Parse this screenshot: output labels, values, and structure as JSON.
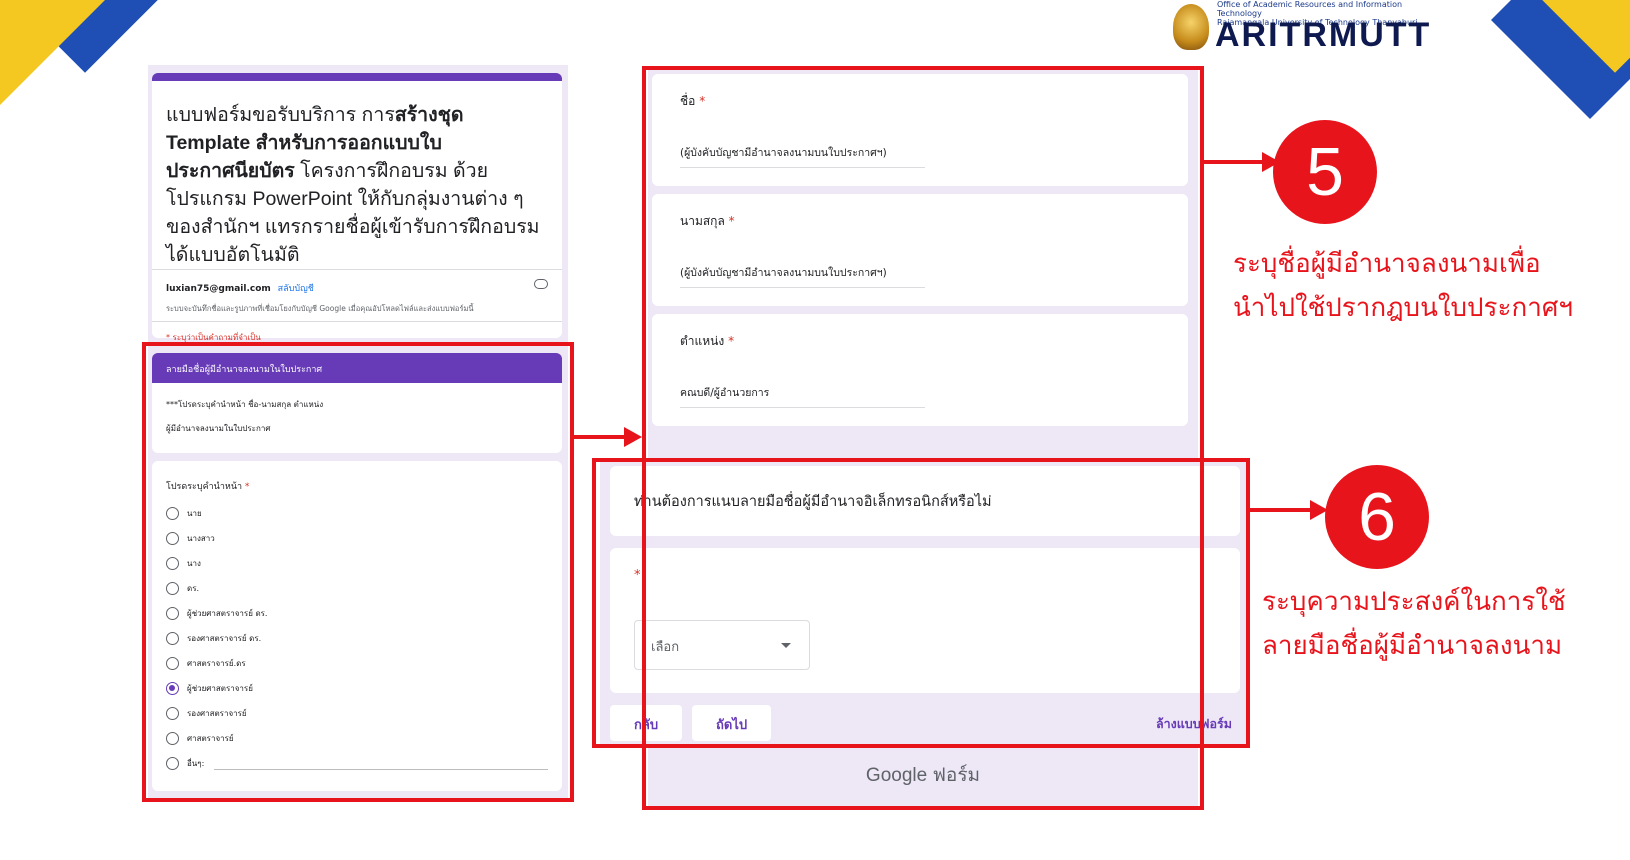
{
  "logo": {
    "subtitle_1": "Office of Academic Resources and Information Technology",
    "subtitle_2": "Rajamangala University of Technology Thanyaburi",
    "name": "ARITRMUTT"
  },
  "form": {
    "title_part1": "แบบฟอร์มขอรับบริการ การ",
    "title_bold1": "สร้างชุด Template สำหรับการออกแบบใบประกาศนียบัตร",
    "title_part2": " โครงการฝึกอบรม ด้วยโปรแกรม PowerPoint ให้กับกลุ่มงานต่าง ๆ ของสำนักฯ แทรกรายชื่อผู้เข้ารับการฝึกอบรมได้แบบอัตโนมัติ",
    "account_email": "luxian75@gmail.com",
    "switch_account": "สลับบัญชี",
    "account_note": "ระบบจะบันทึกชื่อและรูปภาพที่เชื่อมโยงกับบัญชี Google เมื่อคุณอัปโหลดไฟล์และส่งแบบฟอร์มนี้",
    "required_note": "* ระบุว่าเป็นคำถามที่จำเป็น"
  },
  "section": {
    "header": "ลายมือชื่อผู้มีอำนาจลงนามในใบประกาศ",
    "line1": "***โปรดระบุคำนำหน้า ชื่อ-นามสกุล ตำแหน่ง",
    "line2": "ผู้มีอำนาจลงนามในใบประกาศ"
  },
  "prefix_question": {
    "label": "โปรดระบุคำนำหน้า",
    "required_mark": "*",
    "options": [
      "นาย",
      "นางสาว",
      "นาง",
      "ดร.",
      "ผู้ช่วยศาสตราจารย์ ดร.",
      "รองศาสตราจารย์ ดร.",
      "ศาสตราจารย์.ดร",
      "ผู้ช่วยศาสตราจารย์",
      "รองศาสตราจารย์",
      "ศาสตราจารย์",
      "อื่นๆ:"
    ],
    "selected_index": 7
  },
  "fields": [
    {
      "label": "ชื่อ",
      "required_mark": "*",
      "value": "(ผู้บังคับบัญชามีอำนาจลงนามบนใบประกาศฯ)"
    },
    {
      "label": "นามสกุล",
      "required_mark": "*",
      "value": "(ผู้บังคับบัญชามีอำนาจลงนามบนใบประกาศฯ)"
    },
    {
      "label": "ตำแหน่ง",
      "required_mark": "*",
      "value": "คณบดี/ผู้อำนวยการ"
    }
  ],
  "esign_question": {
    "title": "ท่านต้องการแนบลายมือชื่อผู้มีอำนาจอิเล็กทรอนิกส์หรือไม่",
    "required_mark": "*",
    "select_placeholder": "เลือก"
  },
  "buttons": {
    "back": "กลับ",
    "next": "ถัดไป",
    "clear": "ล้างแบบฟอร์ม"
  },
  "footer": "Google ฟอร์ม",
  "annotations": {
    "badge5": "5",
    "note5_line1": "ระบุชื่อผู้มีอำนาจลงนามเพื่อ",
    "note5_line2": "นำไปใช้ปรากฎบนใบประกาศฯ",
    "badge6": "6",
    "note6_line1": "ระบุความประสงค์ในการใช้",
    "note6_line2": "ลายมือชื่อผู้มีอำนาจลงนาม"
  },
  "colors": {
    "form_accent": "#673ab7",
    "highlight_red": "#e8141c",
    "corner_yellow": "#f4c820",
    "corner_blue": "#1f4fb4"
  }
}
